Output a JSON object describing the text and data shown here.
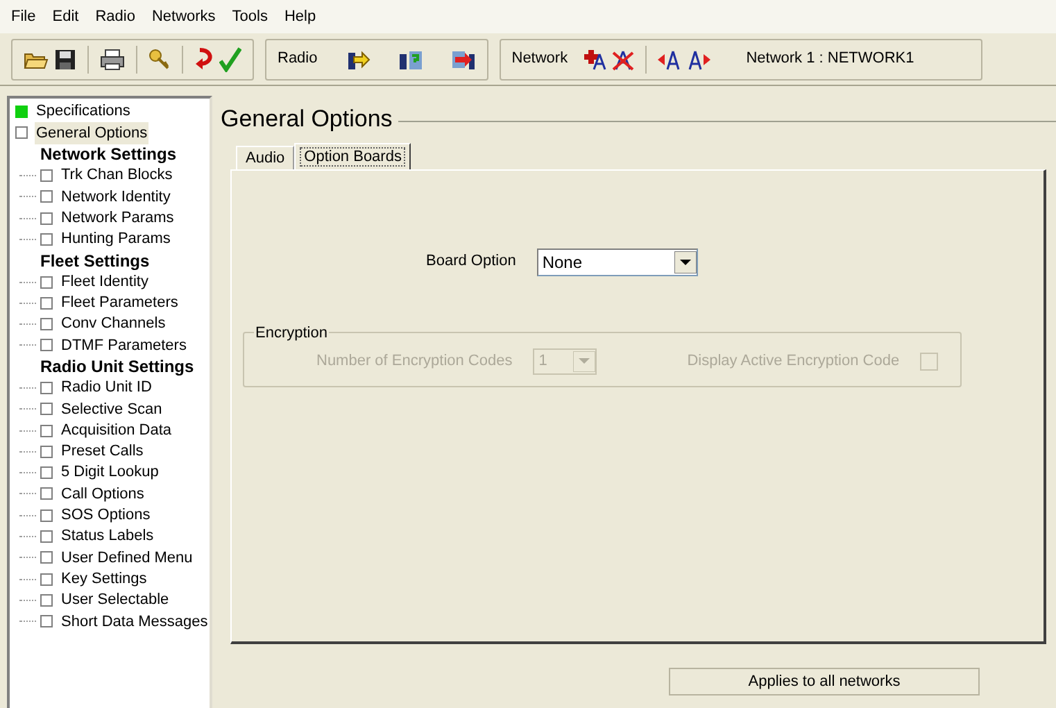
{
  "menu": [
    "File",
    "Edit",
    "Radio",
    "Networks",
    "Tools",
    "Help"
  ],
  "radio_toolbar": {
    "label": "Radio"
  },
  "network_toolbar": {
    "label": "Network",
    "current": "Network 1 : NETWORK1"
  },
  "tree": [
    {
      "kind": "page",
      "label": "Specifications",
      "checked": true,
      "selected": false
    },
    {
      "kind": "page",
      "label": "General Options",
      "checked": false,
      "selected": true
    },
    {
      "kind": "group",
      "label": "Network Settings",
      "children": [
        {
          "kind": "page",
          "label": "Trk Chan Blocks",
          "checked": false,
          "selected": false
        },
        {
          "kind": "page",
          "label": "Network Identity",
          "checked": false,
          "selected": false
        },
        {
          "kind": "page",
          "label": "Network Params",
          "checked": false,
          "selected": false
        },
        {
          "kind": "page",
          "label": "Hunting Params",
          "checked": false,
          "selected": false
        }
      ]
    },
    {
      "kind": "group",
      "label": "Fleet Settings",
      "children": [
        {
          "kind": "page",
          "label": "Fleet Identity",
          "checked": false,
          "selected": false
        },
        {
          "kind": "page",
          "label": "Fleet Parameters",
          "checked": false,
          "selected": false
        },
        {
          "kind": "page",
          "label": "Conv Channels",
          "checked": false,
          "selected": false
        },
        {
          "kind": "page",
          "label": "DTMF Parameters",
          "checked": false,
          "selected": false
        }
      ]
    },
    {
      "kind": "group",
      "label": "Radio Unit Settings",
      "children": [
        {
          "kind": "page",
          "label": "Radio Unit ID",
          "checked": false,
          "selected": false
        },
        {
          "kind": "page",
          "label": "Selective Scan",
          "checked": false,
          "selected": false
        },
        {
          "kind": "page",
          "label": "Acquisition Data",
          "checked": false,
          "selected": false
        },
        {
          "kind": "page",
          "label": "Preset Calls",
          "checked": false,
          "selected": false
        },
        {
          "kind": "page",
          "label": "5 Digit Lookup",
          "checked": false,
          "selected": false
        },
        {
          "kind": "page",
          "label": "Call Options",
          "checked": false,
          "selected": false
        },
        {
          "kind": "page",
          "label": "SOS Options",
          "checked": false,
          "selected": false
        },
        {
          "kind": "page",
          "label": "Status Labels",
          "checked": false,
          "selected": false
        },
        {
          "kind": "page",
          "label": "User Defined Menu",
          "checked": false,
          "selected": false
        },
        {
          "kind": "page",
          "label": "Key Settings",
          "checked": false,
          "selected": false
        },
        {
          "kind": "page",
          "label": "User Selectable",
          "checked": false,
          "selected": false
        },
        {
          "kind": "page",
          "label": "Short Data Messages",
          "checked": false,
          "selected": false
        }
      ]
    }
  ],
  "page_title": "General Options",
  "tabs": [
    {
      "label": "Audio",
      "selected": false
    },
    {
      "label": "Option Boards",
      "selected": true
    }
  ],
  "board_option": {
    "label": "Board Option",
    "value": "None",
    "disabled": false
  },
  "encryption": {
    "title": "Encryption",
    "codes": {
      "label": "Number of Encryption Codes",
      "value": "1",
      "disabled": true
    },
    "display_active": {
      "label": "Display Active Encryption Code",
      "checked": false,
      "disabled": true
    }
  },
  "apply_button": "Applies to all networks"
}
